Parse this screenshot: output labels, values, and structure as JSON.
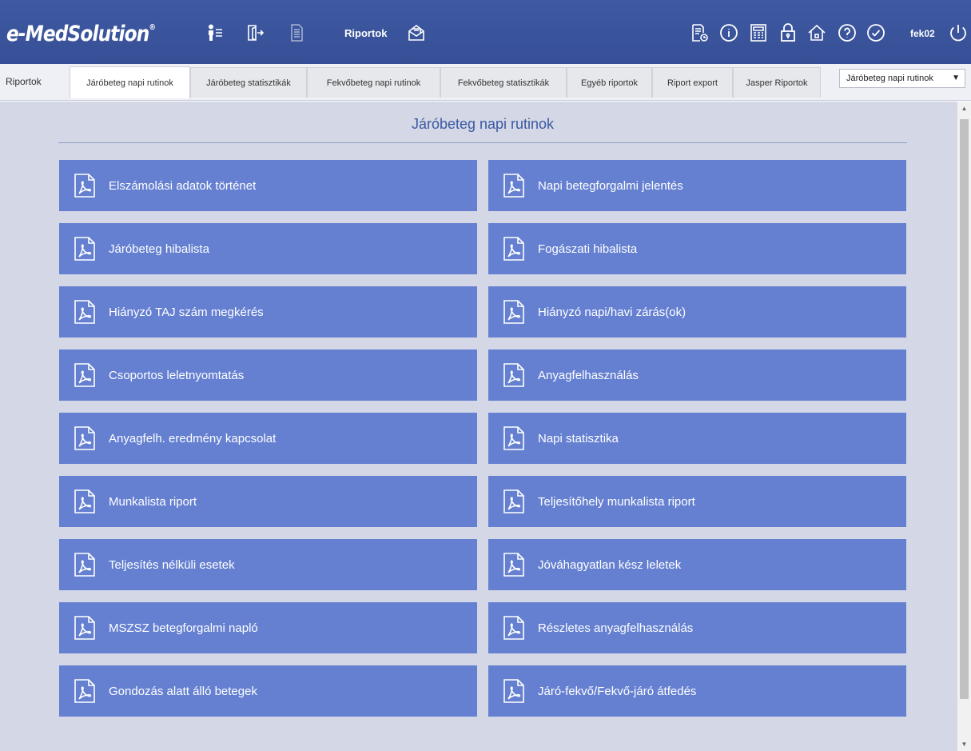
{
  "header": {
    "logo_text": "e-MedSolution",
    "logo_mark": "®",
    "left_icons": [
      "patient-list-icon",
      "exit-door-icon",
      "document-icon"
    ],
    "title": "Riportok",
    "mail_icon": "mail-open-icon",
    "right_icons": [
      "report-clock-icon",
      "info-icon",
      "calculator-icon",
      "lock-icon",
      "home-icon",
      "help-icon",
      "check-icon"
    ],
    "username": "fek02",
    "power_icon": "power-icon"
  },
  "tabbar": {
    "label": "Riportok",
    "tabs": [
      {
        "label": "Járóbeteg napi rutinok",
        "active": true
      },
      {
        "label": "Járóbeteg statisztikák",
        "active": false
      },
      {
        "label": "Fekvőbeteg napi rutinok",
        "active": false
      },
      {
        "label": "Fekvőbeteg statisztikák",
        "active": false
      },
      {
        "label": "Egyéb riportok",
        "active": false
      },
      {
        "label": "Riport export",
        "active": false
      },
      {
        "label": "Jasper Riportok",
        "active": false
      }
    ],
    "select_value": "Járóbeteg napi rutinok"
  },
  "main": {
    "title": "Járóbeteg napi rutinok",
    "reports_left": [
      "Elszámolási adatok történet",
      "Járóbeteg hibalista",
      "Hiányzó TAJ szám megkérés",
      "Csoportos leletnyomtatás",
      "Anyagfelh. eredmény kapcsolat",
      "Munkalista riport",
      "Teljesítés nélküli esetek",
      "MSZSZ betegforgalmi napló",
      "Gondozás alatt álló betegek"
    ],
    "reports_right": [
      "Napi betegforgalmi jelentés",
      "Fogászati hibalista",
      "Hiányzó napi/havi zárás(ok)",
      "Anyagfelhasználás",
      "Napi statisztika",
      "Teljesítőhely munkalista riport",
      "Jóváhagyatlan kész leletek",
      "Részletes anyagfelhasználás",
      "Járó-fekvő/Fekvő-járó átfedés"
    ]
  },
  "colors": {
    "header_bg": "#3a549c",
    "button_bg": "#6580d1",
    "content_bg": "#d3d7e6",
    "title_color": "#3c5aa0"
  }
}
